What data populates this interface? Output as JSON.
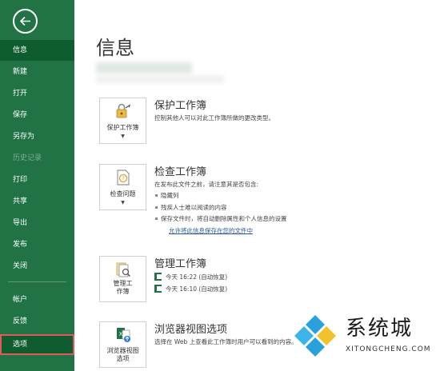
{
  "sidebar": {
    "items": [
      {
        "label": "信息"
      },
      {
        "label": "新建"
      },
      {
        "label": "打开"
      },
      {
        "label": "保存"
      },
      {
        "label": "另存为"
      },
      {
        "label": "历史记录"
      },
      {
        "label": "打印"
      },
      {
        "label": "共享"
      },
      {
        "label": "导出"
      },
      {
        "label": "发布"
      },
      {
        "label": "关闭"
      },
      {
        "label": "帐户"
      },
      {
        "label": "反馈"
      },
      {
        "label": "选项"
      }
    ],
    "colors": {
      "background": "#217346",
      "active": "#0e5c2f",
      "highlight_border": "#e05a5a"
    }
  },
  "main": {
    "title": "信息",
    "protect": {
      "button_label": "保护工作簿",
      "title": "保护工作簿",
      "desc": "控制其他人可以对此工作簿所做的更改类型。",
      "icon": "lock-key-icon"
    },
    "inspect": {
      "button_label": "检查问题",
      "title": "检查工作簿",
      "desc": "在发布此文件之前，请注意其是否包含:",
      "bullets": [
        "隐藏列",
        "残疾人士难以阅读的内容",
        "保存文件时，将自动删除属性和个人信息的设置"
      ],
      "link": "允许将此信息保存在您的文件中",
      "icon": "inspect-document-icon"
    },
    "manage": {
      "button_label_1": "管理工",
      "button_label_2": "作簿",
      "title": "管理工作簿",
      "versions": [
        "今天 16:22 (自动恢复)",
        "今天 16:10 (自动恢复)"
      ],
      "icon": "manage-workbook-icon"
    },
    "browser": {
      "button_label_1": "浏览器视图",
      "button_label_2": "选项",
      "title": "浏览器视图选项",
      "desc": "选择在 Web 上查看此工作簿时用户可以看到的内容。",
      "icon": "browser-view-icon"
    }
  },
  "watermark": {
    "text": "系统城",
    "sub": "XITONGCHENG.COM"
  }
}
